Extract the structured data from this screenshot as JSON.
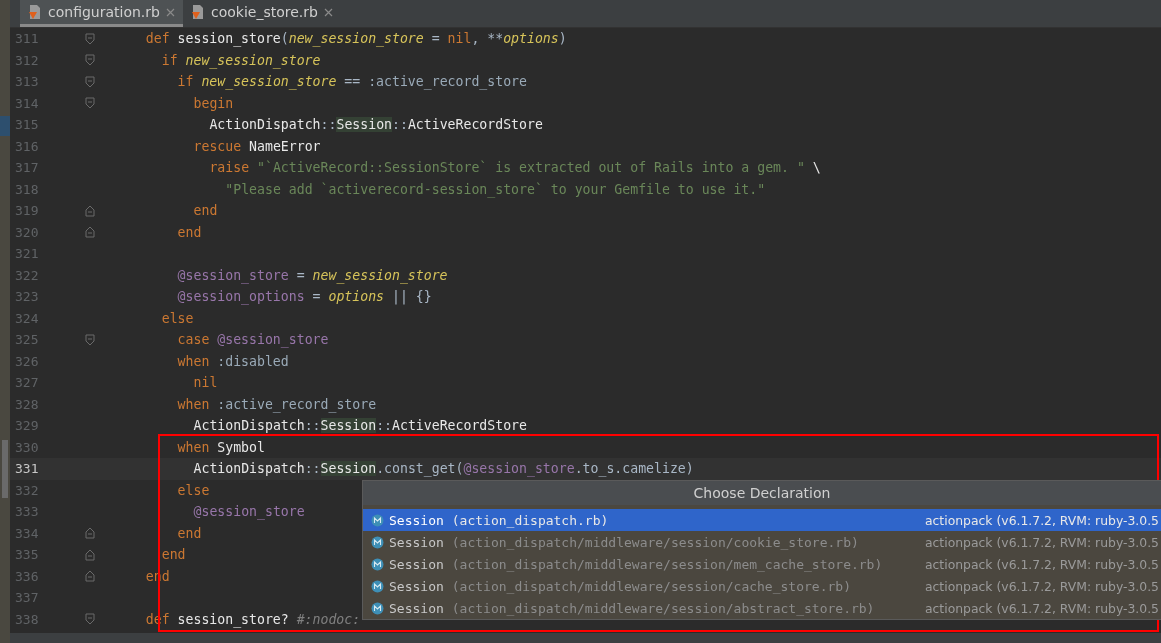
{
  "tabs": [
    {
      "label": "configuration.rb",
      "selected": true
    },
    {
      "label": "cookie_store.rb",
      "selected": false
    }
  ],
  "editor": {
    "lines": [
      {
        "number": "311",
        "fold": {
          "kind": "start"
        },
        "current": false,
        "tokens": [
          {
            "kind": "kw",
            "text": "def "
          },
          {
            "kind": "id",
            "text": "session_store"
          },
          {
            "kind": "punc",
            "text": "("
          },
          {
            "kind": "param",
            "text": "new_session_store"
          },
          {
            "kind": "punc",
            "text": " = "
          },
          {
            "kind": "kw",
            "text": "nil"
          },
          {
            "kind": "punc",
            "text": ", **"
          },
          {
            "kind": "param",
            "text": "options"
          },
          {
            "kind": "punc",
            "text": ")"
          }
        ],
        "children": [
          {
            "number": "312",
            "fold": {
              "kind": "start"
            },
            "current": false,
            "tokens": [
              {
                "kind": "kw",
                "text": "if "
              },
              {
                "kind": "param",
                "text": "new_session_store"
              }
            ],
            "children": [
              {
                "number": "313",
                "fold": {
                  "kind": "start"
                },
                "current": false,
                "tokens": [
                  {
                    "kind": "kw",
                    "text": "if "
                  },
                  {
                    "kind": "param",
                    "text": "new_session_store"
                  },
                  {
                    "kind": "punc",
                    "text": " == "
                  },
                  {
                    "kind": "sym",
                    "text": ":active_record_store"
                  }
                ],
                "children": [
                  {
                    "number": "314",
                    "fold": {
                      "kind": "start"
                    },
                    "current": false,
                    "tokens": [
                      {
                        "kind": "kw",
                        "text": "begin"
                      }
                    ],
                    "children": [
                      {
                        "number": "315",
                        "current": false,
                        "tokens": [
                          {
                            "kind": "id",
                            "text": "ActionDispatch"
                          },
                          {
                            "kind": "punc",
                            "text": "::"
                          },
                          {
                            "kind": "hl",
                            "text": "Session"
                          },
                          {
                            "kind": "punc",
                            "text": "::"
                          },
                          {
                            "kind": "id",
                            "text": "ActiveRecordStore"
                          }
                        ]
                      }
                    ]
                  },
                  {
                    "number": "316",
                    "current": false,
                    "tokens": [
                      {
                        "kind": "kw",
                        "text": "rescue "
                      },
                      {
                        "kind": "id",
                        "text": "NameError"
                      }
                    ],
                    "children": [
                      {
                        "number": "317",
                        "current": false,
                        "tokens": [
                          {
                            "kind": "kw",
                            "text": "raise "
                          },
                          {
                            "kind": "str",
                            "text": "\"`ActiveRecord::SessionStore` is extracted out of Rails into a gem. \" "
                          },
                          {
                            "kind": "id",
                            "text": "\\"
                          }
                        ],
                        "children": [
                          {
                            "number": "318",
                            "current": false,
                            "tokens": [
                              {
                                "kind": "str",
                                "text": "\"Please add `activerecord-session_store` to your Gemfile to use it.\""
                              }
                            ]
                          }
                        ]
                      }
                    ]
                  },
                  {
                    "number": "319",
                    "fold": {
                      "kind": "end"
                    },
                    "current": false,
                    "tokens": [
                      {
                        "kind": "kw",
                        "text": "end"
                      }
                    ]
                  }
                ]
              },
              {
                "number": "320",
                "fold": {
                  "kind": "end"
                },
                "current": false,
                "tokens": [
                  {
                    "kind": "kw",
                    "text": "end"
                  }
                ]
              },
              {
                "number": "321",
                "current": false
              },
              {
                "number": "322",
                "current": false,
                "tokens": [
                  {
                    "kind": "ivar",
                    "text": "@session_store"
                  },
                  {
                    "kind": "punc",
                    "text": " = "
                  },
                  {
                    "kind": "param",
                    "text": "new_session_store"
                  }
                ]
              },
              {
                "number": "323",
                "current": false,
                "tokens": [
                  {
                    "kind": "ivar",
                    "text": "@session_options"
                  },
                  {
                    "kind": "punc",
                    "text": " = "
                  },
                  {
                    "kind": "param",
                    "text": "options"
                  },
                  {
                    "kind": "punc",
                    "text": " || {}"
                  }
                ]
              }
            ]
          },
          {
            "number": "324",
            "current": false,
            "tokens": [
              {
                "kind": "kw",
                "text": "else"
              }
            ],
            "children": [
              {
                "number": "325",
                "fold": {
                  "kind": "start"
                },
                "current": false,
                "tokens": [
                  {
                    "kind": "kw",
                    "text": "case "
                  },
                  {
                    "kind": "ivar",
                    "text": "@session_store"
                  }
                ]
              },
              {
                "number": "326",
                "current": false,
                "tokens": [
                  {
                    "kind": "kw",
                    "text": "when "
                  },
                  {
                    "kind": "sym",
                    "text": ":disabled"
                  }
                ],
                "children": [
                  {
                    "number": "327",
                    "current": false,
                    "tokens": [
                      {
                        "kind": "kw",
                        "text": "nil"
                      }
                    ]
                  }
                ]
              },
              {
                "number": "328",
                "current": false,
                "tokens": [
                  {
                    "kind": "kw",
                    "text": "when "
                  },
                  {
                    "kind": "sym",
                    "text": ":active_record_store"
                  }
                ],
                "children": [
                  {
                    "number": "329",
                    "current": false,
                    "tokens": [
                      {
                        "kind": "id",
                        "text": "ActionDispatch"
                      },
                      {
                        "kind": "punc",
                        "text": "::"
                      },
                      {
                        "kind": "hl",
                        "text": "Session"
                      },
                      {
                        "kind": "punc",
                        "text": "::"
                      },
                      {
                        "kind": "id",
                        "text": "ActiveRecordStore"
                      }
                    ]
                  }
                ]
              },
              {
                "number": "330",
                "current": false,
                "tokens": [
                  {
                    "kind": "kw",
                    "text": "when "
                  },
                  {
                    "kind": "id",
                    "text": "Symbol"
                  }
                ],
                "children": [
                  {
                    "number": "331",
                    "current": true,
                    "tokens": [
                      {
                        "kind": "id",
                        "text": "ActionDispatch"
                      },
                      {
                        "kind": "punc",
                        "text": "::"
                      },
                      {
                        "kind": "hl",
                        "text": "Session"
                      },
                      {
                        "kind": "meth",
                        "text": ".const_get("
                      },
                      {
                        "kind": "ivar",
                        "text": "@session_store"
                      },
                      {
                        "kind": "meth",
                        "text": ".to_s.camelize)"
                      }
                    ]
                  }
                ]
              },
              {
                "number": "332",
                "current": false,
                "tokens": [
                  {
                    "kind": "kw",
                    "text": "else"
                  }
                ],
                "children": [
                  {
                    "number": "333",
                    "current": false,
                    "tokens": [
                      {
                        "kind": "ivar",
                        "text": "@session_store"
                      }
                    ]
                  }
                ]
              },
              {
                "number": "334",
                "fold": {
                  "kind": "end"
                },
                "current": false,
                "tokens": [
                  {
                    "kind": "kw",
                    "text": "end"
                  }
                ]
              }
            ]
          },
          {
            "number": "335",
            "fold": {
              "kind": "end"
            },
            "current": false,
            "tokens": [
              {
                "kind": "kw",
                "text": "end"
              }
            ]
          }
        ]
      },
      {
        "number": "336",
        "fold": {
          "kind": "end"
        },
        "current": false,
        "tokens": [
          {
            "kind": "kw",
            "text": "end"
          }
        ]
      },
      {
        "number": "337",
        "current": false
      },
      {
        "number": "338",
        "fold": {
          "kind": "start"
        },
        "current": false,
        "tokens": [
          {
            "kind": "kw",
            "text": "def "
          },
          {
            "kind": "id",
            "text": "session_store? "
          },
          {
            "kind": "cmt",
            "text": "#:nodoc:"
          }
        ]
      }
    ]
  },
  "popup": {
    "title": "Choose Declaration",
    "items": [
      {
        "name": "Session",
        "path": "(action_dispatch.rb)",
        "source": "actionpack (v6.1.7.2, RVM: ruby-3.0.5",
        "selected": true
      },
      {
        "name": "Session",
        "path": "(action_dispatch/middleware/session/cookie_store.rb)",
        "source": "actionpack (v6.1.7.2, RVM: ruby-3.0.5",
        "selected": false
      },
      {
        "name": "Session",
        "path": "(action_dispatch/middleware/session/mem_cache_store.rb)",
        "source": "actionpack (v6.1.7.2, RVM: ruby-3.0.5",
        "selected": false
      },
      {
        "name": "Session",
        "path": "(action_dispatch/middleware/session/cache_store.rb)",
        "source": "actionpack (v6.1.7.2, RVM: ruby-3.0.5",
        "selected": false
      },
      {
        "name": "Session",
        "path": "(action_dispatch/middleware/session/abstract_store.rb)",
        "source": "actionpack (v6.1.7.2, RVM: ruby-3.0.5",
        "selected": false
      }
    ]
  }
}
